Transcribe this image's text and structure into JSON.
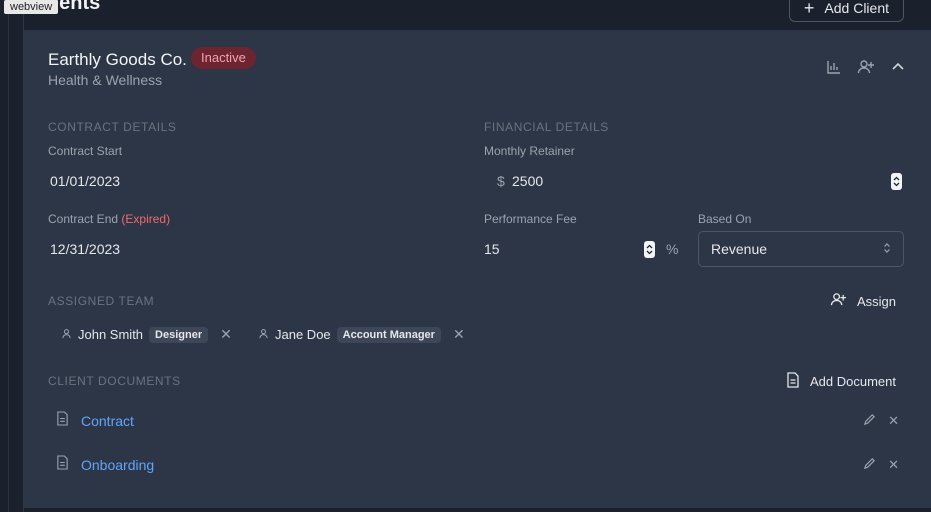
{
  "webview_tag": "webview",
  "page": {
    "heading": "lients",
    "add_client_label": "Add Client"
  },
  "client": {
    "name": "Earthly Goods Co.",
    "status": "Inactive",
    "category": "Health & Wellness"
  },
  "contract": {
    "section_title": "CONTRACT DETAILS",
    "start_label": "Contract Start",
    "start_value": "01/01/2023",
    "end_label": "Contract End",
    "end_status": "(Expired)",
    "end_value": "12/31/2023"
  },
  "financial": {
    "section_title": "FINANCIAL DETAILS",
    "retainer_label": "Monthly Retainer",
    "currency_symbol": "$",
    "retainer_value": "2500",
    "fee_label": "Performance Fee",
    "fee_value": "15",
    "fee_unit": "%",
    "based_on_label": "Based On",
    "based_on_value": "Revenue"
  },
  "team": {
    "section_title": "ASSIGNED TEAM",
    "assign_label": "Assign",
    "members": [
      {
        "name": "John Smith",
        "role": "Designer"
      },
      {
        "name": "Jane Doe",
        "role": "Account Manager"
      }
    ]
  },
  "documents": {
    "section_title": "CLIENT DOCUMENTS",
    "add_label": "Add Document",
    "items": [
      {
        "name": "Contract"
      },
      {
        "name": "Onboarding"
      }
    ]
  },
  "colors": {
    "badge_inactive_bg": "#6b2430",
    "link": "#60a5fa",
    "expired": "#ef6b6b"
  }
}
